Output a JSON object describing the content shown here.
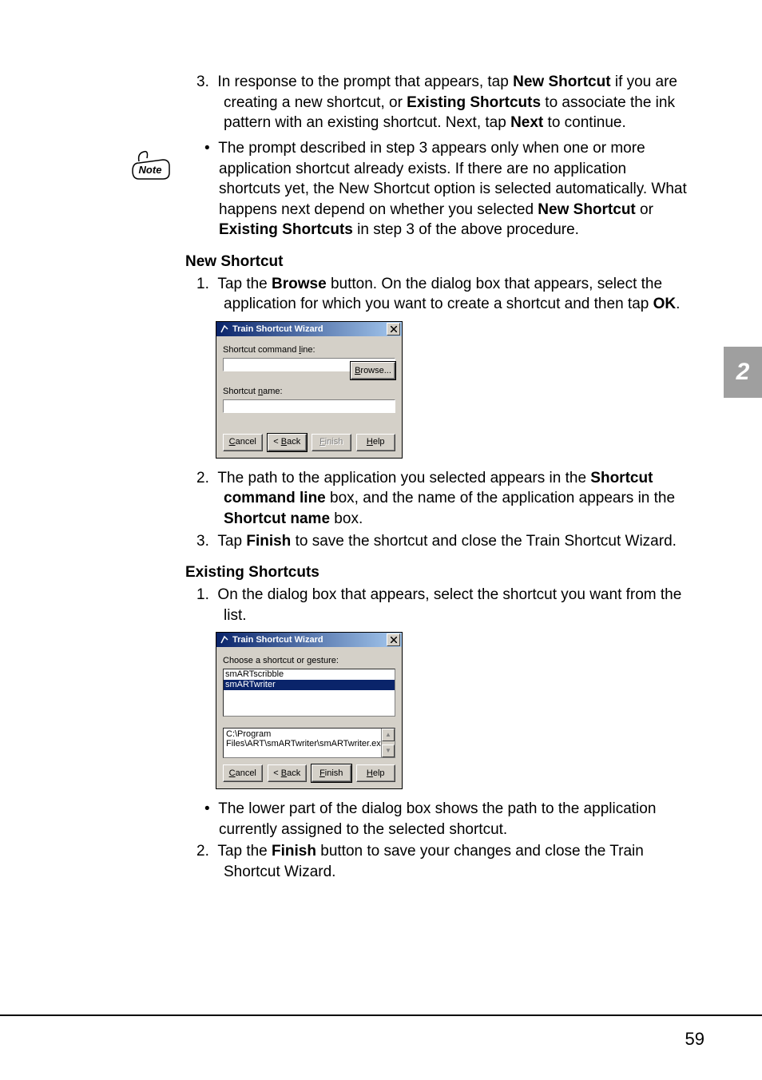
{
  "page_number": "59",
  "sidetab": "2",
  "step3": {
    "num": "3.",
    "t1": "In response to the prompt that appears, tap ",
    "b1": "New Shortcut",
    "t2": " if you are creating a new shortcut, or ",
    "b2": "Existing Shortcuts",
    "t3": " to associate the ink pattern with an existing shortcut. Next, tap ",
    "b3": "Next",
    "t4": " to continue."
  },
  "note_bullet": {
    "dot": "•",
    "t1": "The prompt described in step 3 appears only when one or more application shortcut already exists. If there are no application shortcuts yet, the New Shortcut option is selected automatically. What happens next depend on whether you selected ",
    "b1": "New Shortcut",
    "t2": " or ",
    "b2": "Existing Shortcuts",
    "t3": " in step 3 of the above procedure."
  },
  "ns_heading": "New Shortcut",
  "ns1": {
    "num": "1.",
    "t1": "Tap the ",
    "b1": "Browse",
    "t2": " button. On the dialog box that appears, select the application for which you want to create a shortcut and then tap ",
    "b2": "OK",
    "t3": "."
  },
  "dlg1": {
    "title": "Train Shortcut Wizard",
    "lbl_cmd": "Shortcut command line:",
    "lbl_name": "Shortcut name:",
    "browse": "Browse...",
    "cancel": "Cancel",
    "back": "< Back",
    "finish": "Finish",
    "help": "Help",
    "lbl_cmd_u": "l",
    "lbl_name_u": "n",
    "browse_u": "B",
    "cancel_u": "C",
    "back_u": "B",
    "finish_u": "F",
    "help_u": "H"
  },
  "ns2": {
    "num": "2.",
    "t1": "The path to the application you selected appears in the ",
    "b1": "Shortcut command line",
    "t2": " box, and the name of the application appears in the ",
    "b2": "Shortcut name",
    "t3": " box."
  },
  "ns3": {
    "num": "3.",
    "t1": "Tap ",
    "b1": "Finish",
    "t2": " to save the shortcut and close the Train Shortcut Wizard."
  },
  "es_heading": "Existing Shortcuts",
  "es1": {
    "num": "1.",
    "t1": "On the dialog box that appears, select the shortcut you want from the list."
  },
  "dlg2": {
    "title": "Train Shortcut Wizard",
    "lbl_choose": "Choose a shortcut or gesture:",
    "item0": "smARTscribble",
    "item1": "smARTwriter",
    "path": "C:\\Program Files\\ART\\smARTwriter\\smARTwriter.exe",
    "cancel": "Cancel",
    "back": "< Back",
    "finish": "Finish",
    "help": "Help",
    "cancel_u": "C",
    "back_u": "B",
    "finish_u": "F",
    "help_u": "H"
  },
  "es_bullet": {
    "dot": "•",
    "t1": "The lower part of the dialog box shows the path to the application currently assigned to the selected shortcut."
  },
  "es2": {
    "num": "2.",
    "t1": "Tap the ",
    "b1": "Finish",
    "t2": " button to save your changes and close the Train Shortcut Wizard."
  }
}
